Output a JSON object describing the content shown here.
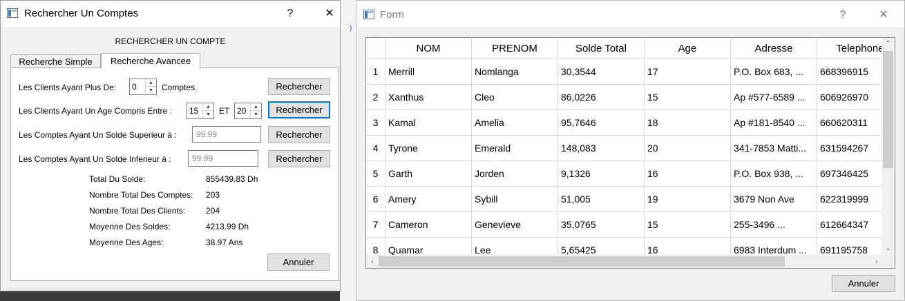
{
  "search_dialog": {
    "title": "Rechercher Un Comptes",
    "help_glyph": "?",
    "close_glyph": "✕",
    "heading": "RECHERCHER UN COMPTE",
    "tabs": [
      {
        "label": "Recherche Simple"
      },
      {
        "label": "Recherche Avancee"
      }
    ],
    "criteria": {
      "more_accounts_label": "Les Clients Ayant Plus De:",
      "more_accounts_value": "0",
      "accounts_suffix": "Comptes.",
      "age_range_label": "Les Clients Ayant Un Age Compris Entre :",
      "age_min": "15",
      "age_and": "ET",
      "age_max": "20",
      "balance_above_label": "Les Comptes Ayant Un Solde Superieur à :",
      "balance_above_placeholder": "99.99",
      "balance_below_label": "Les Comptes Ayant Un Solde Inferieur à :",
      "balance_below_placeholder": "99.99",
      "search_button": "Rechercher"
    },
    "stats": [
      {
        "label": "Total Du Solde:",
        "value": "855439.83 Dh"
      },
      {
        "label": "Nombre Total Des Comptes:",
        "value": "203"
      },
      {
        "label": "Nombre Total Des Clients:",
        "value": "204"
      },
      {
        "label": "Moyenne Des Soldes:",
        "value": "4213.99 Dh"
      },
      {
        "label": "Moyenne Des Ages:",
        "value": "38.97 Ans"
      }
    ],
    "cancel_button": "Annuler"
  },
  "form_window": {
    "title": "Form",
    "help_glyph": "?",
    "close_glyph": "✕",
    "columns": [
      "NOM",
      "PRENOM",
      "Solde Total",
      "Age",
      "Adresse",
      "Telephone"
    ],
    "rows": [
      {
        "num": "1",
        "cells": [
          "Merrill",
          "Nomlanga",
          "30,3544",
          "17",
          "P.O. Box 683, ...",
          "668396915"
        ]
      },
      {
        "num": "2",
        "cells": [
          "Xanthus",
          "Cleo",
          "86,0226",
          "15",
          "Ap #577-6589 ...",
          "606926970"
        ]
      },
      {
        "num": "3",
        "cells": [
          "Kamal",
          "Amelia",
          "95,7646",
          "18",
          "Ap #181-8540 ...",
          "660620311"
        ]
      },
      {
        "num": "4",
        "cells": [
          "Tyrone",
          "Emerald",
          "148,083",
          "20",
          "341-7853 Matti...",
          "631594267"
        ]
      },
      {
        "num": "5",
        "cells": [
          "Garth",
          "Jorden",
          "9,1326",
          "16",
          "P.O. Box 938, ...",
          "697346425"
        ]
      },
      {
        "num": "6",
        "cells": [
          "Amery",
          "Sybill",
          "51,005",
          "19",
          "3679 Non Ave",
          "622319999"
        ]
      },
      {
        "num": "7",
        "cells": [
          "Cameron",
          "Genevieve",
          "35,0765",
          "15",
          "255-3496 ...",
          "612664347"
        ]
      },
      {
        "num": "8",
        "cells": [
          "Quamar",
          "Lee",
          "5,65425",
          "16",
          "6983 Interdum ...",
          "691195758"
        ]
      }
    ],
    "cancel_button": "Annuler"
  }
}
